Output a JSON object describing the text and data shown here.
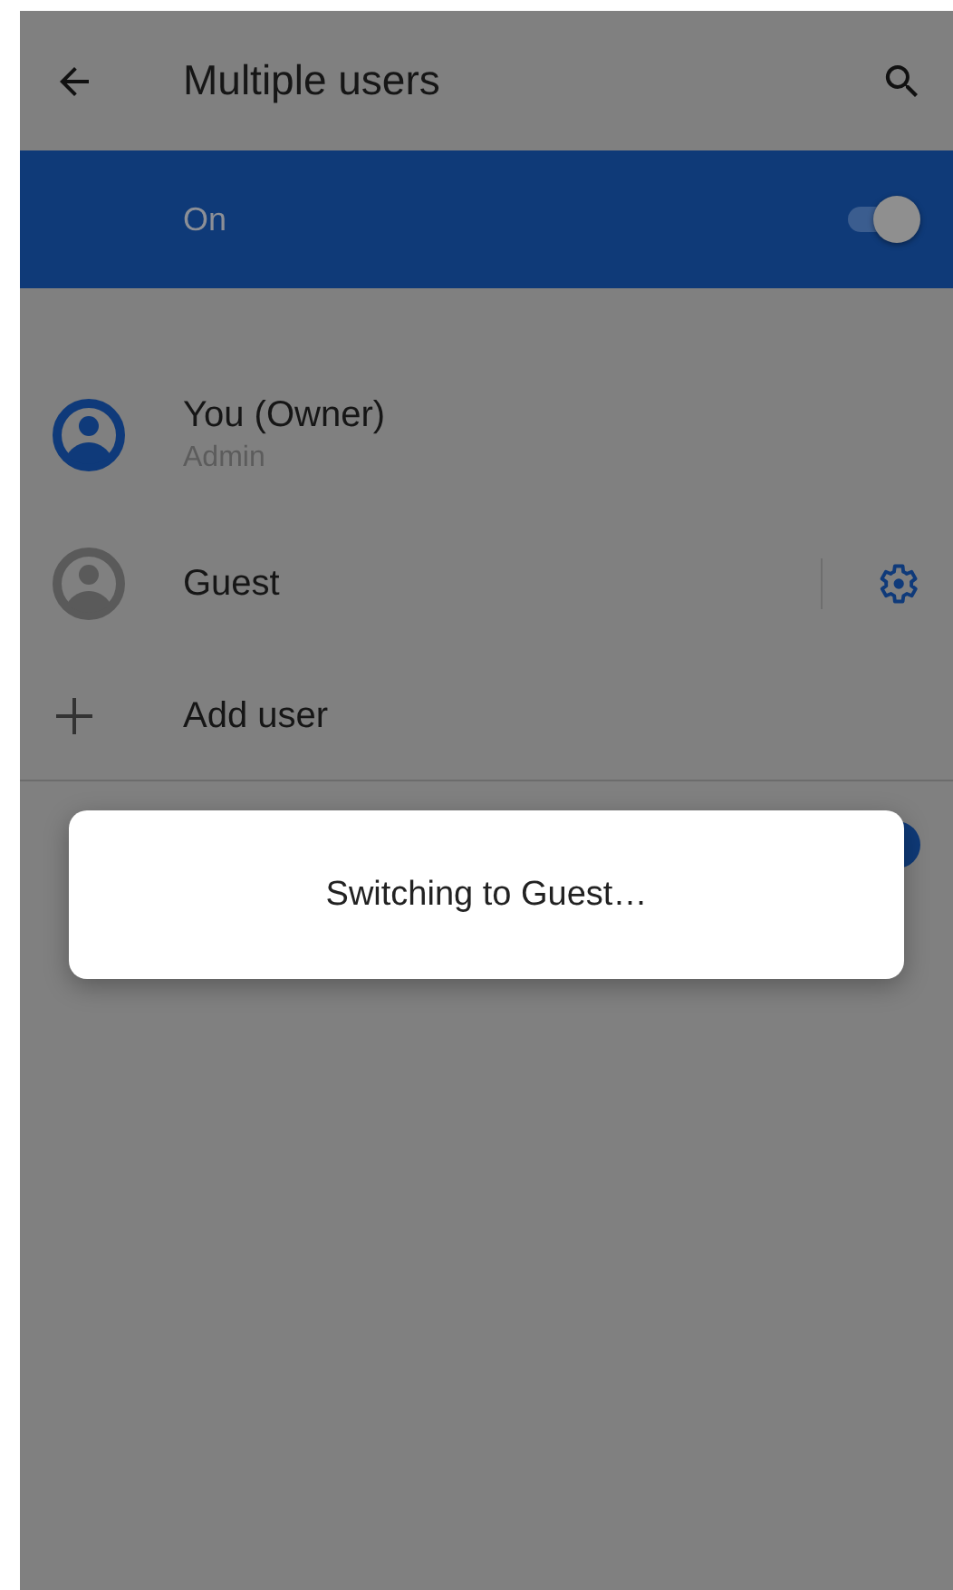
{
  "toolbar": {
    "title": "Multiple users"
  },
  "master_switch": {
    "label": "On",
    "on": true
  },
  "users": [
    {
      "kind": "owner",
      "name": "You (Owner)",
      "role": "Admin"
    },
    {
      "kind": "guest",
      "name": "Guest"
    },
    {
      "kind": "add",
      "name": "Add user"
    }
  ],
  "partial_switch": {
    "on": true
  },
  "dialog": {
    "message": "Switching to Guest…"
  }
}
